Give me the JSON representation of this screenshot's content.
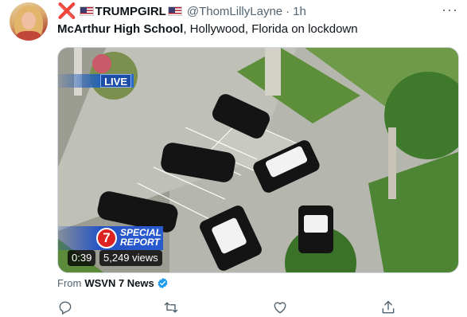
{
  "tweet": {
    "display_name": "TRUMPGIRL",
    "handle": "@ThomLillyLayne",
    "separator": "·",
    "time": "1h",
    "cross_glyph": "❌",
    "more_glyph": "···",
    "text_bold": "McArthur High School",
    "text_rest": ", Hollywood, Florida on lockdown"
  },
  "media": {
    "live_label": "LIVE",
    "channel_number": "7",
    "special_line1": "SPECIAL",
    "special_line2": "REPORT",
    "duration": "0:39",
    "views": "5,249 views"
  },
  "source": {
    "prefix": "From",
    "name": "WSVN 7 News"
  },
  "icons": {
    "reply": "reply-icon",
    "retweet": "retweet-icon",
    "like": "like-icon",
    "share": "share-icon",
    "verified": "verified-badge-icon",
    "more": "more-icon",
    "flag": "us-flag-icon",
    "cross": "red-cross-icon"
  },
  "colors": {
    "text": "#0f1419",
    "secondary": "#536471",
    "verified": "#1d9bf0",
    "cross": "#d2243a",
    "live_blue": "#1c4ea8"
  }
}
